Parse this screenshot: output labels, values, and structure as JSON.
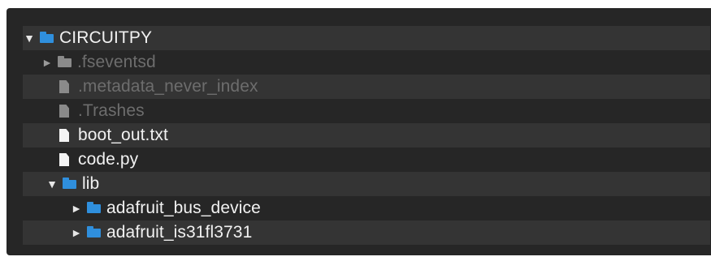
{
  "tree": {
    "root": {
      "label": "CIRCUITPY",
      "expanded": true,
      "toggle_glyph": "▼",
      "icon": "folder-icon"
    },
    "items": [
      {
        "label": ".fseventsd",
        "type": "folder",
        "hidden": true,
        "expanded": false,
        "toggle_glyph": "►",
        "icon": "folder-icon"
      },
      {
        "label": ".metadata_never_index",
        "type": "file",
        "hidden": true,
        "icon": "file-icon"
      },
      {
        "label": ".Trashes",
        "type": "file",
        "hidden": true,
        "icon": "file-icon"
      },
      {
        "label": "boot_out.txt",
        "type": "file",
        "hidden": false,
        "icon": "file-icon"
      },
      {
        "label": "code.py",
        "type": "file",
        "hidden": false,
        "icon": "file-icon"
      },
      {
        "label": "lib",
        "type": "folder",
        "hidden": false,
        "expanded": true,
        "toggle_glyph": "▼",
        "icon": "folder-icon"
      }
    ],
    "lib_items": [
      {
        "label": "adafruit_bus_device",
        "type": "folder",
        "expanded": false,
        "toggle_glyph": "►",
        "icon": "folder-icon"
      },
      {
        "label": "adafruit_is31fl3731",
        "type": "folder",
        "expanded": false,
        "toggle_glyph": "►",
        "icon": "folder-icon"
      }
    ]
  },
  "colors": {
    "background": "#262626",
    "alt_row": "#343434",
    "folder": "#2f8fdd",
    "text": "#f1f1f1",
    "dim_text": "#6d6d6d"
  }
}
